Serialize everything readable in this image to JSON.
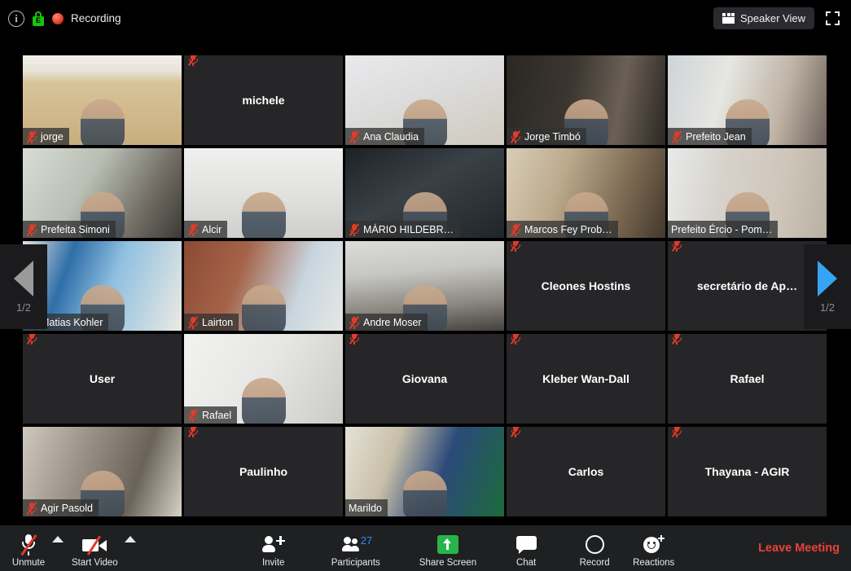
{
  "topbar": {
    "info_icon": "info-icon",
    "encryption_icon": "encryption-lock-icon",
    "encryption_letter": "E",
    "recording_dot_icon": "recording-dot-icon",
    "recording_label": "Recording",
    "view_button_label": "Speaker View",
    "view_button_icon": "gallery-layout-icon",
    "fullscreen_icon": "fullscreen-icon"
  },
  "pager": {
    "left_icon": "previous-page-arrow-icon",
    "right_icon": "next-page-arrow-icon",
    "left_count": "1/2",
    "right_count": "1/2",
    "left_arrow_color": "#9a9a9a",
    "right_arrow_color": "#35a4f4"
  },
  "grid": {
    "active_border_color": "#a8d80b",
    "tiles": [
      {
        "name": "jorge",
        "video": true,
        "muted": true,
        "active": false,
        "scene": "wood-room"
      },
      {
        "name": "michele",
        "video": false,
        "muted": true,
        "active": false,
        "scene": ""
      },
      {
        "name": "Ana Claudia",
        "video": true,
        "muted": true,
        "active": false,
        "scene": "bedroom-light"
      },
      {
        "name": "Jorge Timbó",
        "video": true,
        "muted": true,
        "active": false,
        "scene": "dark-room-window"
      },
      {
        "name": "Prefeito Jean",
        "video": true,
        "muted": true,
        "active": false,
        "scene": "corridor-light"
      },
      {
        "name": "Prefeita Simoni",
        "video": true,
        "muted": true,
        "active": false,
        "scene": "office-plant"
      },
      {
        "name": "Alcir",
        "video": true,
        "muted": true,
        "active": false,
        "scene": "white-wall-man"
      },
      {
        "name": "MÁRIO HILDEBR…",
        "video": true,
        "muted": true,
        "active": false,
        "scene": "dark-indoor"
      },
      {
        "name": "Marcos Fey Prob…",
        "video": true,
        "muted": true,
        "active": false,
        "scene": "bookshelf"
      },
      {
        "name": "Prefeito Ércio - Pom…",
        "video": true,
        "muted": false,
        "active": true,
        "scene": "office-blinds"
      },
      {
        "name": "Matias Kohler",
        "video": true,
        "muted": true,
        "active": false,
        "scene": "blue-poster"
      },
      {
        "name": "Lairton",
        "video": true,
        "muted": true,
        "active": false,
        "scene": "brick-wall"
      },
      {
        "name": "Andre Moser",
        "video": true,
        "muted": true,
        "active": false,
        "scene": "ceiling-room"
      },
      {
        "name": "Cleones Hostins",
        "video": false,
        "muted": true,
        "active": false,
        "scene": ""
      },
      {
        "name": "secretário de Ap…",
        "video": false,
        "muted": true,
        "active": false,
        "scene": ""
      },
      {
        "name": "User",
        "video": false,
        "muted": true,
        "active": false,
        "scene": ""
      },
      {
        "name": "Rafael",
        "video": true,
        "muted": true,
        "active": false,
        "scene": "white-room-glasses"
      },
      {
        "name": "Giovana",
        "video": false,
        "muted": true,
        "active": false,
        "scene": ""
      },
      {
        "name": "Kleber Wan-Dall",
        "video": false,
        "muted": true,
        "active": false,
        "scene": ""
      },
      {
        "name": "Rafael",
        "video": false,
        "muted": true,
        "active": false,
        "scene": ""
      },
      {
        "name": "Agir Pasold",
        "video": true,
        "muted": true,
        "active": false,
        "scene": "living-room-old"
      },
      {
        "name": "Paulinho",
        "video": false,
        "muted": true,
        "active": false,
        "scene": ""
      },
      {
        "name": "Marildo",
        "video": true,
        "muted": false,
        "active": false,
        "scene": "flag-room"
      },
      {
        "name": "Carlos",
        "video": false,
        "muted": true,
        "active": false,
        "scene": ""
      },
      {
        "name": "Thayana - AGIR",
        "video": false,
        "muted": true,
        "active": false,
        "scene": ""
      }
    ]
  },
  "toolbar": {
    "unmute_label": "Unmute",
    "unmute_icon": "microphone-muted-icon",
    "audio_caret_icon": "chevron-up-icon",
    "start_video_label": "Start Video",
    "start_video_icon": "camera-off-icon",
    "video_caret_icon": "chevron-up-icon",
    "invite_label": "Invite",
    "invite_icon": "add-person-icon",
    "participants_label": "Participants",
    "participants_icon": "people-icon",
    "participants_count": "27",
    "participants_count_color": "#2d8cff",
    "share_label": "Share Screen",
    "share_icon": "share-screen-icon",
    "share_color": "#27b44b",
    "chat_label": "Chat",
    "chat_icon": "chat-bubble-icon",
    "record_label": "Record",
    "record_icon": "record-circle-icon",
    "reactions_label": "Reactions",
    "reactions_icon": "smiley-plus-icon",
    "leave_label": "Leave Meeting",
    "leave_color": "#ea4335"
  }
}
